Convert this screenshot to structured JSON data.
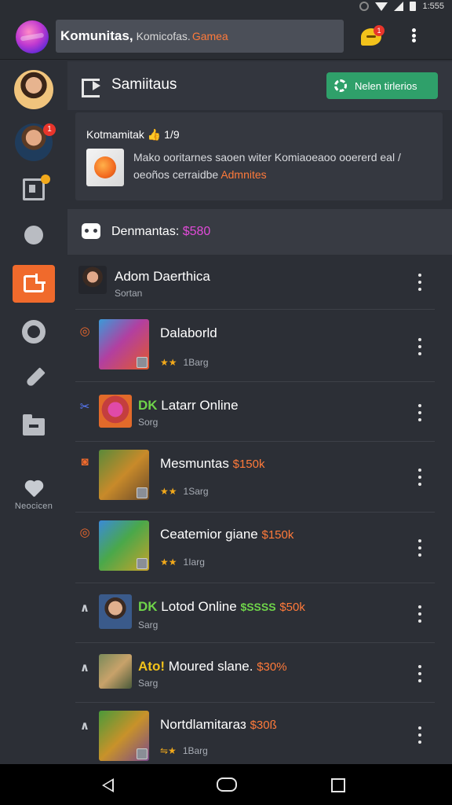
{
  "status_bar": {
    "time": "1:555"
  },
  "header": {
    "search_title": "Komunitas,",
    "search_sub": "Komicofas.",
    "search_accent": "Gamea",
    "notification_count": "1"
  },
  "sidebar": {
    "avatar2_badge": "1",
    "bottom_label": "Neocicen"
  },
  "main_header": {
    "title": "Samiitaus",
    "button_label": "Nelen tirlerios"
  },
  "card": {
    "title": "Kotmamitak",
    "title_icon": "👍",
    "title_count": "1/9",
    "text": "Mako ooritarnes saoen witer Komiaoeaoo ooererd eal / oeoños cerraidbe",
    "text_highlight": "Admnites"
  },
  "section": {
    "title": "Denmantas:",
    "amount": "$580"
  },
  "rows": [
    {
      "marker": "",
      "prefix": "",
      "name": "Adom Daerthica",
      "price": "",
      "stars": "",
      "sub": "Sortan"
    },
    {
      "marker": "◎",
      "prefix": "",
      "name": "Dalaborld",
      "price": "",
      "stars": "★★",
      "sub": "1Barg"
    },
    {
      "marker": "✂",
      "prefix": "DK",
      "name": "Latarr Online",
      "price": "",
      "stars": "",
      "sub": "Sorg"
    },
    {
      "marker": "◙",
      "prefix": "",
      "name": "Mesmuntas",
      "price": "$150k",
      "stars": "★★",
      "sub": "1Sarg"
    },
    {
      "marker": "◎",
      "prefix": "",
      "name": "Ceatemior giane",
      "price": "$150k",
      "stars": "★★",
      "sub": "1Iarg"
    },
    {
      "marker": "∧",
      "prefix": "DK",
      "name": "Lotod Online",
      "badge": "$SSSS",
      "price": "$50k",
      "stars": "",
      "sub": "Sarg"
    },
    {
      "marker": "∧",
      "prefix": "Ato!",
      "name": "Moured slane.",
      "price": "$30%",
      "stars": "",
      "sub": "Sarg"
    },
    {
      "marker": "∧",
      "prefix": "",
      "name": "Nortdlamitaraɜ",
      "price": "$30ß",
      "stars": "⇋★",
      "sub": "1Barg"
    }
  ],
  "colors": {
    "accent_orange": "#f06a2c",
    "accent_green": "#2fa06a",
    "price_orange": "#ff7a3a",
    "amount_pink": "#e14bd8"
  }
}
